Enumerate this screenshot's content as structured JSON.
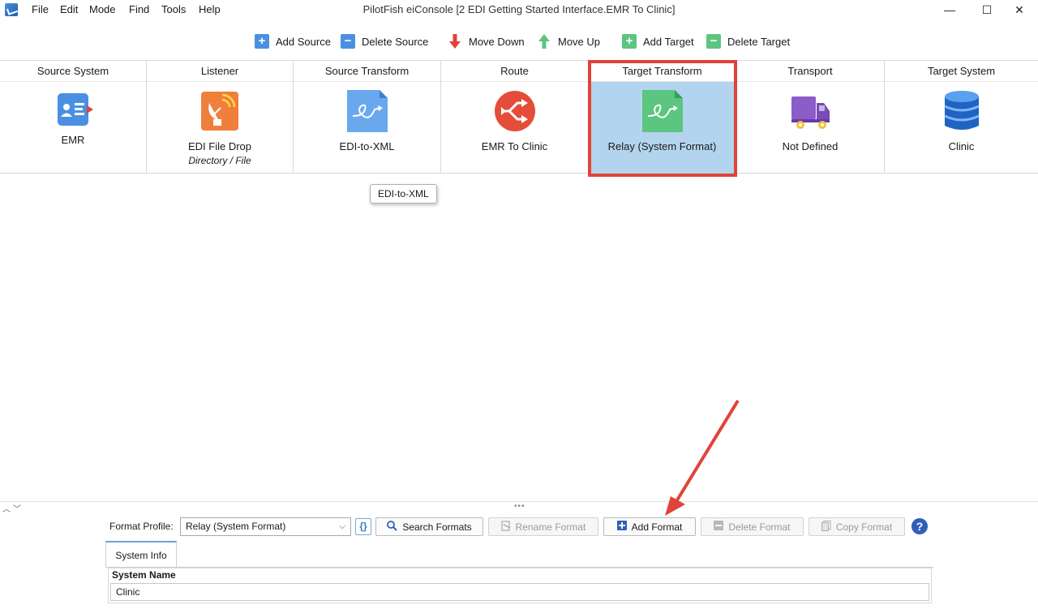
{
  "window": {
    "title": "PilotFish eiConsole [2 EDI Getting Started Interface.EMR To Clinic]",
    "controls": {
      "minimize": "—",
      "maximize": "☐",
      "close": "✕"
    }
  },
  "menu": [
    "File",
    "Edit",
    "Mode",
    "Find",
    "Tools",
    "Help"
  ],
  "toolbar": {
    "add_source": "Add Source",
    "delete_source": "Delete Source",
    "move_down": "Move Down",
    "move_up": "Move Up",
    "add_target": "Add Target",
    "delete_target": "Delete Target"
  },
  "stages": [
    {
      "header": "Source System",
      "label": "EMR",
      "icon": "id-card-icon"
    },
    {
      "header": "Listener",
      "label": "EDI File Drop",
      "sublabel": "Directory / File",
      "icon": "satellite-dish-icon"
    },
    {
      "header": "Source Transform",
      "label": "EDI-to-XML",
      "icon": "transform-file-icon"
    },
    {
      "header": "Route",
      "label": "EMR To Clinic",
      "icon": "route-icon"
    },
    {
      "header": "Target Transform",
      "label": "Relay (System Format)",
      "icon": "transform-file-icon",
      "selected": true
    },
    {
      "header": "Transport",
      "label": "Not Defined",
      "icon": "truck-icon"
    },
    {
      "header": "Target System",
      "label": "Clinic",
      "icon": "database-icon"
    }
  ],
  "tooltip": "EDI-to-XML",
  "format_panel": {
    "profile_label": "Format Profile:",
    "profile_value": "Relay (System Format)",
    "brace_button": "{}",
    "search_formats": "Search Formats",
    "rename_format": "Rename Format",
    "add_format": "Add Format",
    "delete_format": "Delete Format",
    "copy_format": "Copy Format",
    "help": "?"
  },
  "tabs": [
    "System Info"
  ],
  "system_info": {
    "system_name_label": "System Name",
    "system_name_value": "Clinic"
  },
  "colors": {
    "selection": "#b3d4ee",
    "highlight": "#e0433a",
    "add_blue": "#4a90e2",
    "add_green": "#5cc57f",
    "down_red": "#e0433a",
    "up_green": "#5cc57f"
  }
}
